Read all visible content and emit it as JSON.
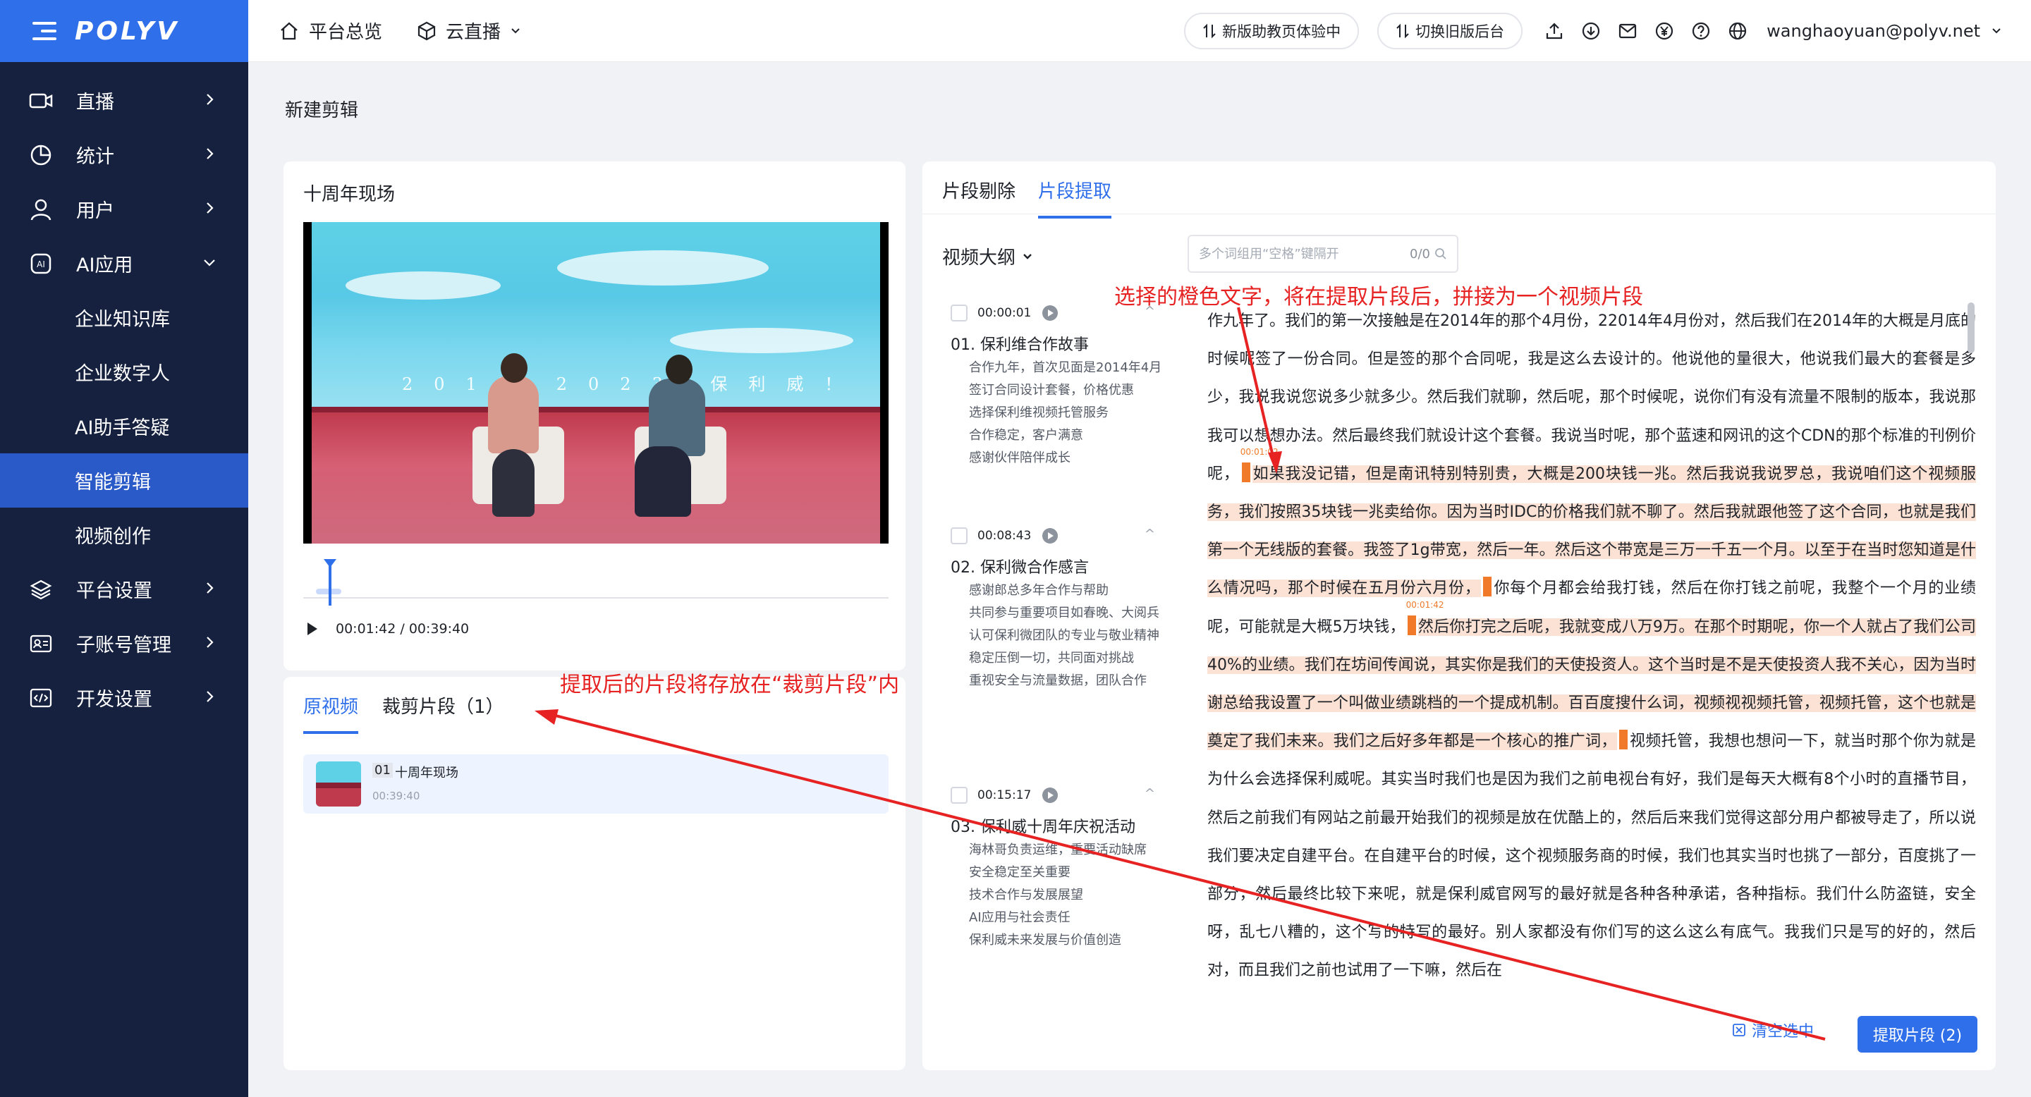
{
  "brand": {
    "logo": "POLYV",
    "accent": "#2f6fea",
    "sidebar_bg": "#15213f",
    "highlight": "#f07a2a"
  },
  "sidebar": {
    "items": [
      {
        "label": "直播",
        "icon": "video-icon"
      },
      {
        "label": "统计",
        "icon": "chart-pie-icon"
      },
      {
        "label": "用户",
        "icon": "user-icon"
      },
      {
        "label": "AI应用",
        "icon": "ai-icon"
      },
      {
        "label": "企业知识库"
      },
      {
        "label": "企业数字人"
      },
      {
        "label": "AI助手答疑"
      },
      {
        "label": "智能剪辑"
      },
      {
        "label": "视频创作"
      },
      {
        "label": "平台设置",
        "icon": "layers-icon"
      },
      {
        "label": "子账号管理",
        "icon": "id-card-icon"
      },
      {
        "label": "开发设置",
        "icon": "code-icon"
      }
    ]
  },
  "header": {
    "nav_home": "平台总览",
    "nav_live": "云直播",
    "btn_new": "新版助教页体验中",
    "btn_old": "切换旧版后台",
    "user": "wanghaoyuan@polyv.net"
  },
  "page": {
    "title": "新建剪辑"
  },
  "player": {
    "title": "十周年现场",
    "banner_text": "2013 2023 保利威！",
    "time": "00:01:42 / 00:39:40",
    "progress_fraction": 0.043
  },
  "clips": {
    "tabs": [
      "原视频",
      "裁剪片段（1）"
    ],
    "items": [
      {
        "index": "01",
        "name": "十周年现场",
        "duration": "00:39:40"
      }
    ]
  },
  "editor": {
    "tabs": [
      "片段剔除",
      "片段提取"
    ],
    "outline_title": "视频大纲",
    "search_placeholder": "多个词组用“空格”键隔开",
    "search_count": "0/0",
    "outline": [
      {
        "time": "00:00:01",
        "title": "01. 保利维合作故事",
        "points": [
          "合作九年，首次见面是2014年4月",
          "签订合同设计套餐，价格优惠",
          "选择保利维视频托管服务",
          "合作稳定，客户满意",
          "感谢伙伴陪伴成长"
        ]
      },
      {
        "time": "00:08:43",
        "title": "02. 保利微合作感言",
        "points": [
          "感谢郎总多年合作与帮助",
          "共同参与重要项目如春晚、大阅兵",
          "认可保利微团队的专业与敬业精神",
          "稳定压倒一切，共同面对挑战",
          "重视安全与流量数据，团队合作"
        ]
      },
      {
        "time": "00:15:17",
        "title": "03. 保利威十周年庆祝活动",
        "points": [
          "海林哥负责运维，重要活动缺席",
          "安全稳定至关重要",
          "技术合作与发展展望",
          "AI应用与社会责任",
          "保利威未来发展与价值创造"
        ]
      }
    ],
    "transcript": {
      "p1": "作九年了。我们的第一次接触是在2014年的那个4月份，22014年4月份对，然后我们在2014年的大概是月底的时候呢签了一份合同。但是签的那个合同呢，我是这么去设计的。他说他的量很大，他说我们最大的套餐是多少，我说我说您说多少就多少。然后我们就聊，然后呢，那个时候呢，说你们有没有流量不限制的版本，我说那我可以想想办法。然后最终我们就设计这个套餐。我说当时呢，那个蓝速和网讯的这个CDN的那个标准的刊例价呢，",
      "m1": "00:01:02",
      "h1": "如果我没记错，但是南讯特别特别贵，大概是200块钱一兆。然后我说我说罗总，我说咱们这个视频服务，我们按照35块钱一兆卖给你。因为当时IDC的价格我们就不聊了。然后我就跟他签了这个合同，也就是我们第一个无线版的套餐。我签了1g带宽，然后一年。然后这个带宽是三万一千五一个月。以至于在当时您知道是什么情况吗，那个时候在五月份六月份，",
      "p2": "你每个月都会给我打钱，然后在你打钱之前呢，我整个一个月的业绩呢，可能就是大概5万块钱，",
      "m2": "00:01:42",
      "h2": "然后你打完之后呢，我就变成八万9万。在那个时期呢，你一个人就占了我们公司40%的业绩。我们在坊间传闻说，其实你是我们的天使投资人。这个当时是不是天使投资人我不关心，因为当时谢总给我设置了一个叫做业绩跳档的一个提成机制。百百度搜什么词，视频视视频托管，视频托管，这个也就是奠定了我们未来。我们之后好多年都是一个核心的推广词，",
      "p3": "视频托管，我想也想问一下，就当时那个你为就是为什么会选择保利威呢。其实当时我们也是因为我们之前电视台有好，我们是每天大概有8个小时的直播节目，然后之前我们有网站之前最开始我们的视频是放在优酷上的，然后后来我们觉得这部分用户都被导走了，所以说我们要决定自建平台。在自建平台的时候，这个视频服务商的时候，我们也其实当时也挑了一部分，百度挑了一部分，然后最终比较下来呢，就是保利威官网写的最好就是各种各种承诺，各种指标。我们什么防盗链，安全呀，乱七八糟的，这个写的特写的最好。别人家都没有你们写的这么这么有底气。我我们只是写的好的，然后对，而且我们之前也试用了一下嘛，然后在"
    },
    "clear_label": "清空选中",
    "extract_label": "提取片段 (2)"
  },
  "annotations": {
    "top": "选择的橙色文字，将在提取片段后，拼接为一个视频片段",
    "left": "提取后的片段将存放在“裁剪片段”内",
    "color": "#e62222"
  }
}
